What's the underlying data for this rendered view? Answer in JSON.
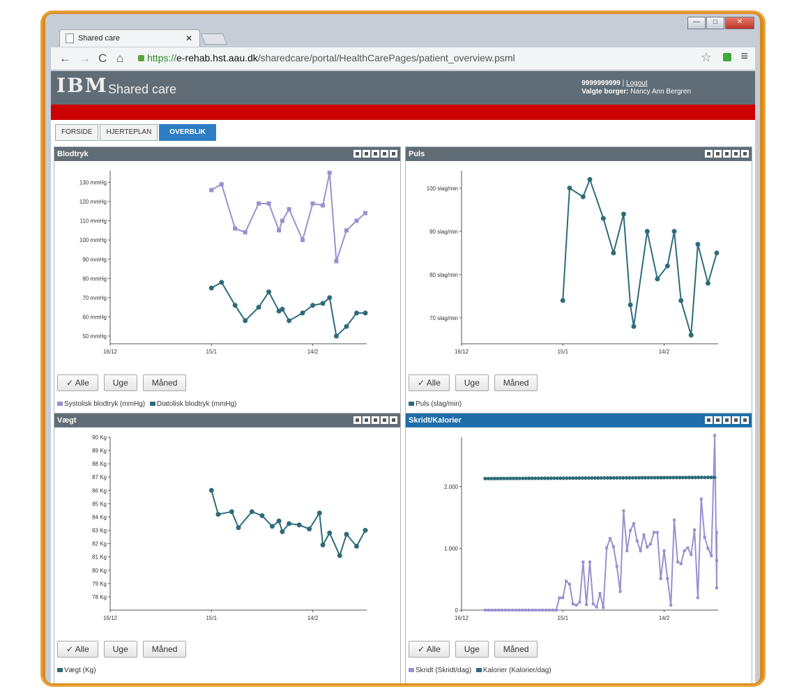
{
  "browser": {
    "tab_title": "Shared care",
    "url_scheme": "https://",
    "url_host": "e-rehab.hst.aau.dk",
    "url_path": "/sharedcare/portal/HealthCarePages/patient_overview.psml"
  },
  "header": {
    "logo": "IBM",
    "app_name": "Shared care",
    "user_id": "9999999999",
    "separator": " | ",
    "logout": "Logout",
    "selected_label": "Valgte borger:",
    "selected_citizen": "Nancy Ann Bergren"
  },
  "nav": {
    "tabs": [
      "FORSIDE",
      "HJERTEPLAN",
      "OVERBLIK"
    ],
    "active": "OVERBLIK"
  },
  "colors": {
    "accent": "#2d7dc4",
    "header": "#616d76",
    "red_bar": "#cc0000",
    "series_purple": "#9b8fd0",
    "series_teal": "#2e6b7a"
  },
  "buttons": {
    "all": "✓ Alle",
    "week": "Uge",
    "month": "Måned"
  },
  "panels": {
    "blodtryk": {
      "title": "Blodtryk",
      "legend": [
        "Systolisk blodtryk (mmHg)",
        "Diatolisk blodtryk (mmHg)"
      ]
    },
    "puls": {
      "title": "Puls",
      "legend": [
        "Puls (slag/min)"
      ]
    },
    "vaegt": {
      "title": "Vægt",
      "legend": [
        "Vægt (Kg)"
      ]
    },
    "skridt": {
      "title": "Skridt/Kalorier",
      "legend": [
        "Skridt (Skridt/dag)",
        "Kalorier (Kalorier/dag)"
      ]
    }
  },
  "chart_data": [
    {
      "type": "line",
      "title": "Blodtryk",
      "x_ticks": [
        "16/12",
        "15/1",
        "14/2"
      ],
      "xlim": [
        0,
        70
      ],
      "y_ticks": [
        "50 mmHg",
        "60 mmHg",
        "70 mmHg",
        "80 mmHg",
        "90 mmHg",
        "100 mmHg",
        "110 mmHg",
        "120 mmHg",
        "130 mmHg"
      ],
      "ylim": [
        46,
        136
      ],
      "series": [
        {
          "name": "Systolisk blodtryk (mmHg)",
          "color": "#9b8fd0",
          "x": [
            30,
            33,
            37,
            40,
            44,
            47,
            50,
            51,
            53,
            57,
            60,
            63,
            65,
            67,
            70,
            73,
            76
          ],
          "values": [
            126,
            129,
            106,
            104,
            119,
            119,
            105,
            110,
            116,
            100,
            119,
            118,
            135,
            89,
            105,
            110,
            114
          ]
        },
        {
          "name": "Diatolisk blodtryk (mmHg)",
          "color": "#2e6b7a",
          "x": [
            30,
            33,
            37,
            40,
            44,
            47,
            50,
            51,
            53,
            57,
            60,
            63,
            65,
            67,
            70,
            73,
            76
          ],
          "values": [
            75,
            78,
            66,
            58,
            65,
            73,
            63,
            64,
            58,
            62,
            66,
            67,
            70,
            50,
            55,
            62,
            62
          ]
        }
      ]
    },
    {
      "type": "line",
      "title": "Puls",
      "x_ticks": [
        "16/12",
        "15/1",
        "14/2"
      ],
      "xlim": [
        0,
        70
      ],
      "y_ticks": [
        "70 slag/min",
        "80 slag/min",
        "90 slag/min",
        "100 slag/min"
      ],
      "ylim": [
        64,
        104
      ],
      "series": [
        {
          "name": "Puls (slag/min)",
          "color": "#2e6b7a",
          "x": [
            30,
            32,
            36,
            38,
            42,
            45,
            48,
            50,
            51,
            55,
            58,
            61,
            63,
            65,
            68,
            70,
            73,
            76
          ],
          "values": [
            74,
            100,
            98,
            102,
            93,
            85,
            94,
            73,
            68,
            90,
            79,
            82,
            90,
            74,
            66,
            87,
            78,
            85
          ]
        }
      ]
    },
    {
      "type": "line",
      "title": "Vægt",
      "x_ticks": [
        "16/12",
        "15/1",
        "14/2"
      ],
      "xlim": [
        0,
        70
      ],
      "y_ticks": [
        "78 Kg",
        "79 Kg",
        "80 Kg",
        "81 Kg",
        "82 Kg",
        "83 Kg",
        "84 Kg",
        "85 Kg",
        "86 Kg",
        "87 Kg",
        "88 Kg",
        "89 Kg",
        "90 Kg"
      ],
      "ylim": [
        77,
        90
      ],
      "series": [
        {
          "name": "Vægt (Kg)",
          "color": "#2e6b7a",
          "x": [
            30,
            32,
            36,
            38,
            42,
            45,
            48,
            50,
            51,
            53,
            56,
            59,
            62,
            63,
            65,
            68,
            70,
            73,
            76
          ],
          "values": [
            86,
            84.2,
            84.4,
            83.2,
            84.4,
            84.1,
            83.3,
            83.7,
            82.9,
            83.5,
            83.4,
            83.1,
            84.3,
            81.9,
            82.8,
            81.1,
            82.7,
            81.8,
            83.0
          ]
        }
      ]
    },
    {
      "type": "line",
      "title": "Skridt/Kalorier",
      "x_ticks": [
        "16/12",
        "15/1",
        "14/2"
      ],
      "xlim": [
        0,
        75
      ],
      "y_ticks": [
        "0",
        "1.000",
        "2.000"
      ],
      "ylim": [
        0,
        2800
      ],
      "series": [
        {
          "name": "Skridt (Skridt/dag)",
          "color": "#9b8fd0",
          "x": [
            7,
            8,
            9,
            10,
            11,
            12,
            13,
            14,
            15,
            16,
            17,
            18,
            19,
            20,
            21,
            22,
            23,
            24,
            25,
            26,
            27,
            28,
            29,
            30,
            31,
            32,
            33,
            34,
            35,
            36,
            37,
            38,
            39,
            40,
            41,
            42,
            43,
            44,
            45,
            46,
            47,
            48,
            49,
            50,
            51,
            52,
            53,
            54,
            55,
            56,
            57,
            58,
            59,
            60,
            61,
            62,
            63,
            64,
            65,
            66,
            67,
            68,
            69,
            70,
            71,
            72,
            73,
            74,
            75,
            76
          ],
          "values": [
            0,
            0,
            0,
            0,
            0,
            0,
            0,
            0,
            0,
            0,
            0,
            0,
            0,
            0,
            0,
            0,
            0,
            0,
            0,
            0,
            0,
            0,
            200,
            200,
            470,
            420,
            100,
            80,
            130,
            780,
            90,
            780,
            100,
            50,
            270,
            40,
            1010,
            1160,
            1030,
            710,
            300,
            1610,
            960,
            1290,
            1400,
            1120,
            960,
            1220,
            1020,
            1070,
            1260,
            1260,
            510,
            960,
            510,
            80,
            1460,
            780,
            750,
            960,
            1010,
            900,
            1300,
            200,
            1800,
            1180,
            1000,
            880,
            2830,
            360
          ],
          "values_end": [
            800,
            1260
          ]
        },
        {
          "name": "Kalorier (Kalorier/dag)",
          "color": "#2e6b7a",
          "x": [
            7,
            22,
            23,
            75
          ],
          "values": [
            2130,
            2140,
            2150,
            2150
          ]
        }
      ]
    }
  ]
}
